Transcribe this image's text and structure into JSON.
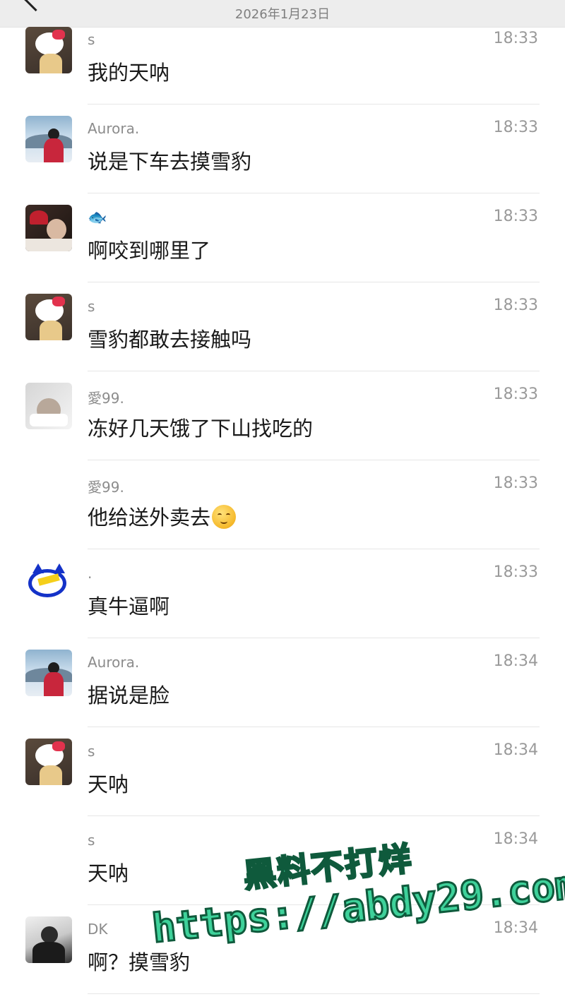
{
  "header": {
    "date": "2026年1月23日"
  },
  "messages": [
    {
      "sender": "s",
      "time": "18:33",
      "text": "我的天呐",
      "avatar": "hello-kitty"
    },
    {
      "sender": "Aurora.",
      "time": "18:33",
      "text": "说是下车去摸雪豹",
      "avatar": "aurora"
    },
    {
      "sender": "🐟",
      "time": "18:33",
      "text": "啊咬到哪里了",
      "avatar": "fish"
    },
    {
      "sender": "s",
      "time": "18:33",
      "text": "雪豹都敢去接触吗",
      "avatar": "hello-kitty"
    },
    {
      "sender": "愛99.",
      "time": "18:33",
      "text": "冻好几天饿了下山找吃的",
      "avatar": "ai99"
    },
    {
      "sender": "愛99.",
      "time": "18:33",
      "text": "他给送外卖去",
      "avatar": "none",
      "emoji": "smiling-face"
    },
    {
      "sender": ".",
      "time": "18:33",
      "text": "真牛逼啊",
      "avatar": "dot"
    },
    {
      "sender": "Aurora.",
      "time": "18:34",
      "text": "据说是脸",
      "avatar": "aurora"
    },
    {
      "sender": "s",
      "time": "18:34",
      "text": "天呐",
      "avatar": "hello-kitty"
    },
    {
      "sender": "s",
      "time": "18:34",
      "text": "天呐",
      "avatar": "none"
    },
    {
      "sender": "DK",
      "time": "18:34",
      "text": "啊？摸雪豹",
      "avatar": "dk"
    }
  ],
  "watermark": {
    "line1": "黑料不打烊",
    "line2": "https://abdy29.com"
  }
}
